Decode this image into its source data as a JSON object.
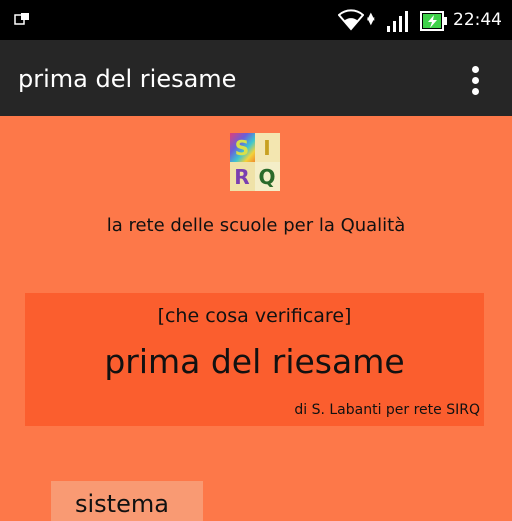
{
  "status_bar": {
    "time": "22:44",
    "icons": [
      "notification-icon",
      "wifi-icon",
      "data-arrows-icon",
      "signal-icon",
      "battery-charging-icon"
    ]
  },
  "app_bar": {
    "title": "prima del riesame",
    "menu_icon": "overflow-menu-icon"
  },
  "logo": {
    "letters": [
      "S",
      "I",
      "R",
      "Q"
    ]
  },
  "tagline": "la rete delle scuole per la Qualità",
  "banner": {
    "subtitle": "[che cosa verificare]",
    "title": "prima del riesame",
    "author": "di S. Labanti per rete SIRQ"
  },
  "sections": [
    {
      "label": "sistema"
    }
  ],
  "colors": {
    "background": "#fd7849",
    "banner": "#fb5e2e",
    "section_button": "#f99a73",
    "app_bar": "#262626",
    "status_bar": "#000000"
  }
}
